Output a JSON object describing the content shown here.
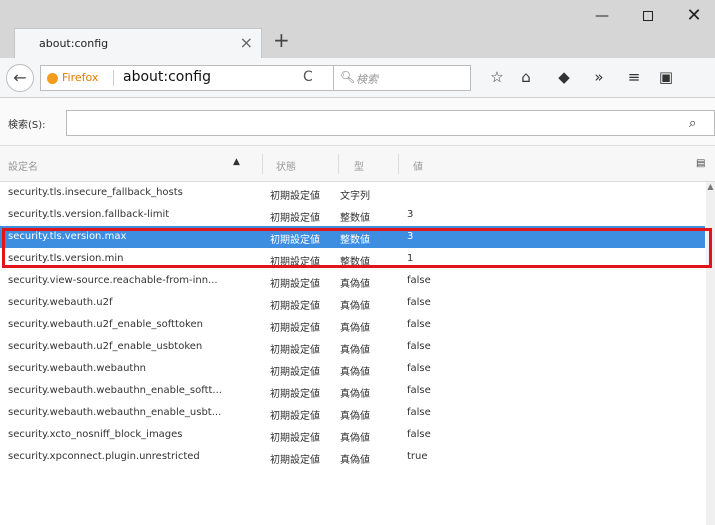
{
  "tab": {
    "title": "about:config",
    "close": "×",
    "new_tab": "+"
  },
  "window": {
    "minimize": "—",
    "close": "✕"
  },
  "navbar": {
    "back": "←",
    "browser_label": "Firefox",
    "url": "about:config",
    "reload": "C",
    "search_placeholder": "検索",
    "icons": {
      "bookmark": "☆",
      "library": "⌂",
      "pocket": "◆",
      "overflow": "»",
      "menu": "≡",
      "extra": "▣"
    }
  },
  "filter": {
    "label": "検索(S):",
    "value": ""
  },
  "table": {
    "headers": {
      "name": "設定名",
      "status": "状態",
      "type": "型",
      "value": "値"
    },
    "rows": [
      {
        "name": "security.tls.insecure_fallback_hosts",
        "status": "初期設定値",
        "type": "文字列",
        "value": ""
      },
      {
        "name": "security.tls.version.fallback-limit",
        "status": "初期設定値",
        "type": "整数値",
        "value": "3"
      },
      {
        "name": "security.tls.version.max",
        "status": "初期設定値",
        "type": "整数値",
        "value": "3"
      },
      {
        "name": "security.tls.version.min",
        "status": "初期設定値",
        "type": "整数値",
        "value": "1"
      },
      {
        "name": "security.view-source.reachable-from-inn...",
        "status": "初期設定値",
        "type": "真偽値",
        "value": "false"
      },
      {
        "name": "security.webauth.u2f",
        "status": "初期設定値",
        "type": "真偽値",
        "value": "false"
      },
      {
        "name": "security.webauth.u2f_enable_softtoken",
        "status": "初期設定値",
        "type": "真偽値",
        "value": "false"
      },
      {
        "name": "security.webauth.u2f_enable_usbtoken",
        "status": "初期設定値",
        "type": "真偽値",
        "value": "false"
      },
      {
        "name": "security.webauth.webauthn",
        "status": "初期設定値",
        "type": "真偽値",
        "value": "false"
      },
      {
        "name": "security.webauth.webauthn_enable_softt...",
        "status": "初期設定値",
        "type": "真偽値",
        "value": "false"
      },
      {
        "name": "security.webauth.webauthn_enable_usbt...",
        "status": "初期設定値",
        "type": "真偽値",
        "value": "false"
      },
      {
        "name": "security.xcto_nosniff_block_images",
        "status": "初期設定値",
        "type": "真偽値",
        "value": "false"
      },
      {
        "name": "security.xpconnect.plugin.unrestricted",
        "status": "初期設定値",
        "type": "真偽値",
        "value": "true"
      }
    ],
    "selected_index": 2
  },
  "colors": {
    "selection": "#3d8ee0",
    "highlight_border": "#e2141b"
  }
}
